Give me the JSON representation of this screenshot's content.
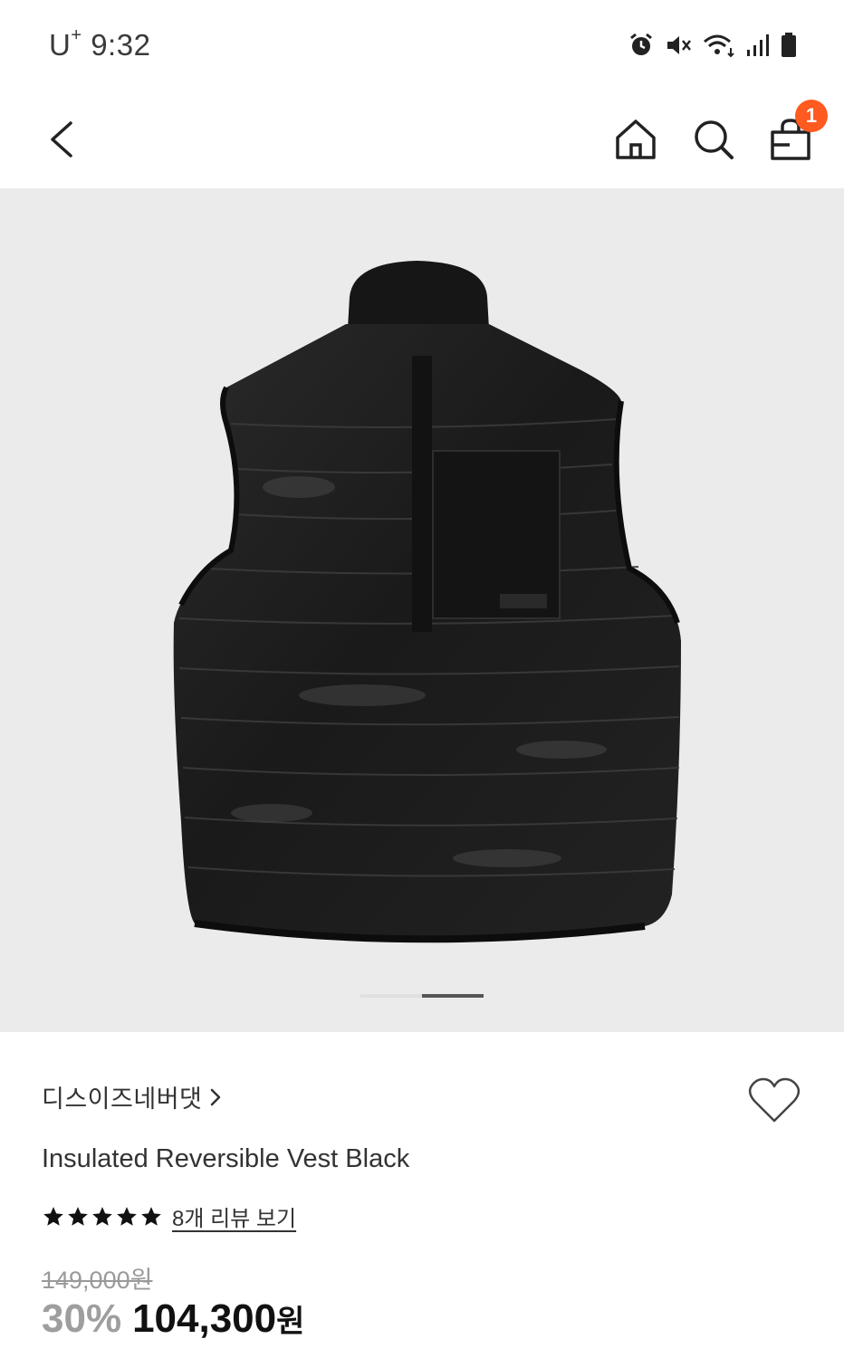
{
  "status_bar": {
    "carrier": "U",
    "carrier_sup": "+",
    "time": "9:32"
  },
  "nav": {
    "cart_count": "1"
  },
  "product": {
    "image_pages": 2,
    "active_page": 2,
    "brand": "디스이즈네버댓",
    "brand_chevron": "›",
    "name": "Insulated Reversible Vest Black",
    "rating_stars": 5,
    "review_link": "8개 리뷰 보기",
    "original_price": "149,000원",
    "discount": "30%",
    "sale_price": "104,300",
    "currency": "원"
  },
  "colors": {
    "badge": "#ff5a1f",
    "image_bg": "#ebebeb"
  }
}
